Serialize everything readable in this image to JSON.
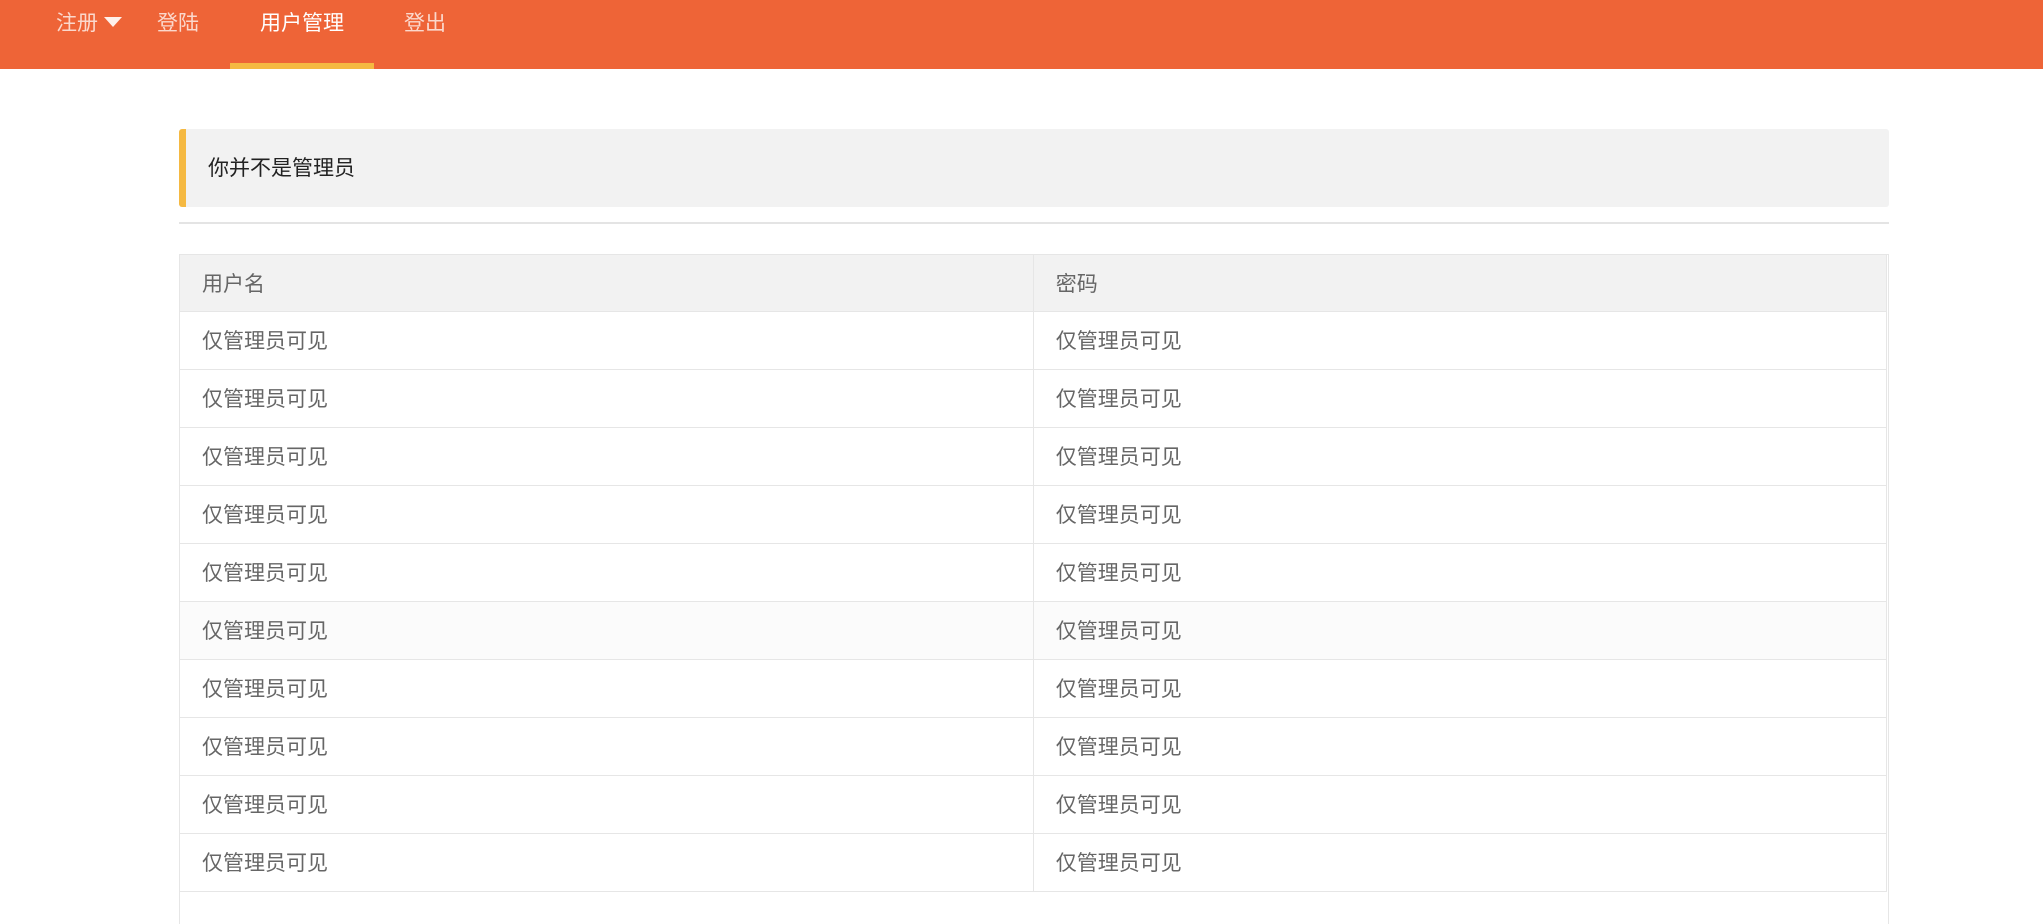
{
  "nav": {
    "items": [
      {
        "label": "注册",
        "has_dropdown": true,
        "active": false
      },
      {
        "label": "登陆",
        "has_dropdown": false,
        "active": false
      },
      {
        "label": "用户管理",
        "has_dropdown": false,
        "active": true
      },
      {
        "label": "登出",
        "has_dropdown": false,
        "active": false
      }
    ],
    "colors": {
      "bar": "#ee6437",
      "active_underline": "#f5b942"
    }
  },
  "notice": {
    "message": "你并不是管理员",
    "accent_color": "#f5b942"
  },
  "table": {
    "columns": [
      "用户名",
      "密码"
    ],
    "rows": [
      [
        "仅管理员可见",
        "仅管理员可见"
      ],
      [
        "仅管理员可见",
        "仅管理员可见"
      ],
      [
        "仅管理员可见",
        "仅管理员可见"
      ],
      [
        "仅管理员可见",
        "仅管理员可见"
      ],
      [
        "仅管理员可见",
        "仅管理员可见"
      ],
      [
        "仅管理员可见",
        "仅管理员可见"
      ],
      [
        "仅管理员可见",
        "仅管理员可见"
      ],
      [
        "仅管理员可见",
        "仅管理员可见"
      ],
      [
        "仅管理员可见",
        "仅管理员可见"
      ],
      [
        "仅管理员可见",
        "仅管理员可见"
      ]
    ]
  }
}
